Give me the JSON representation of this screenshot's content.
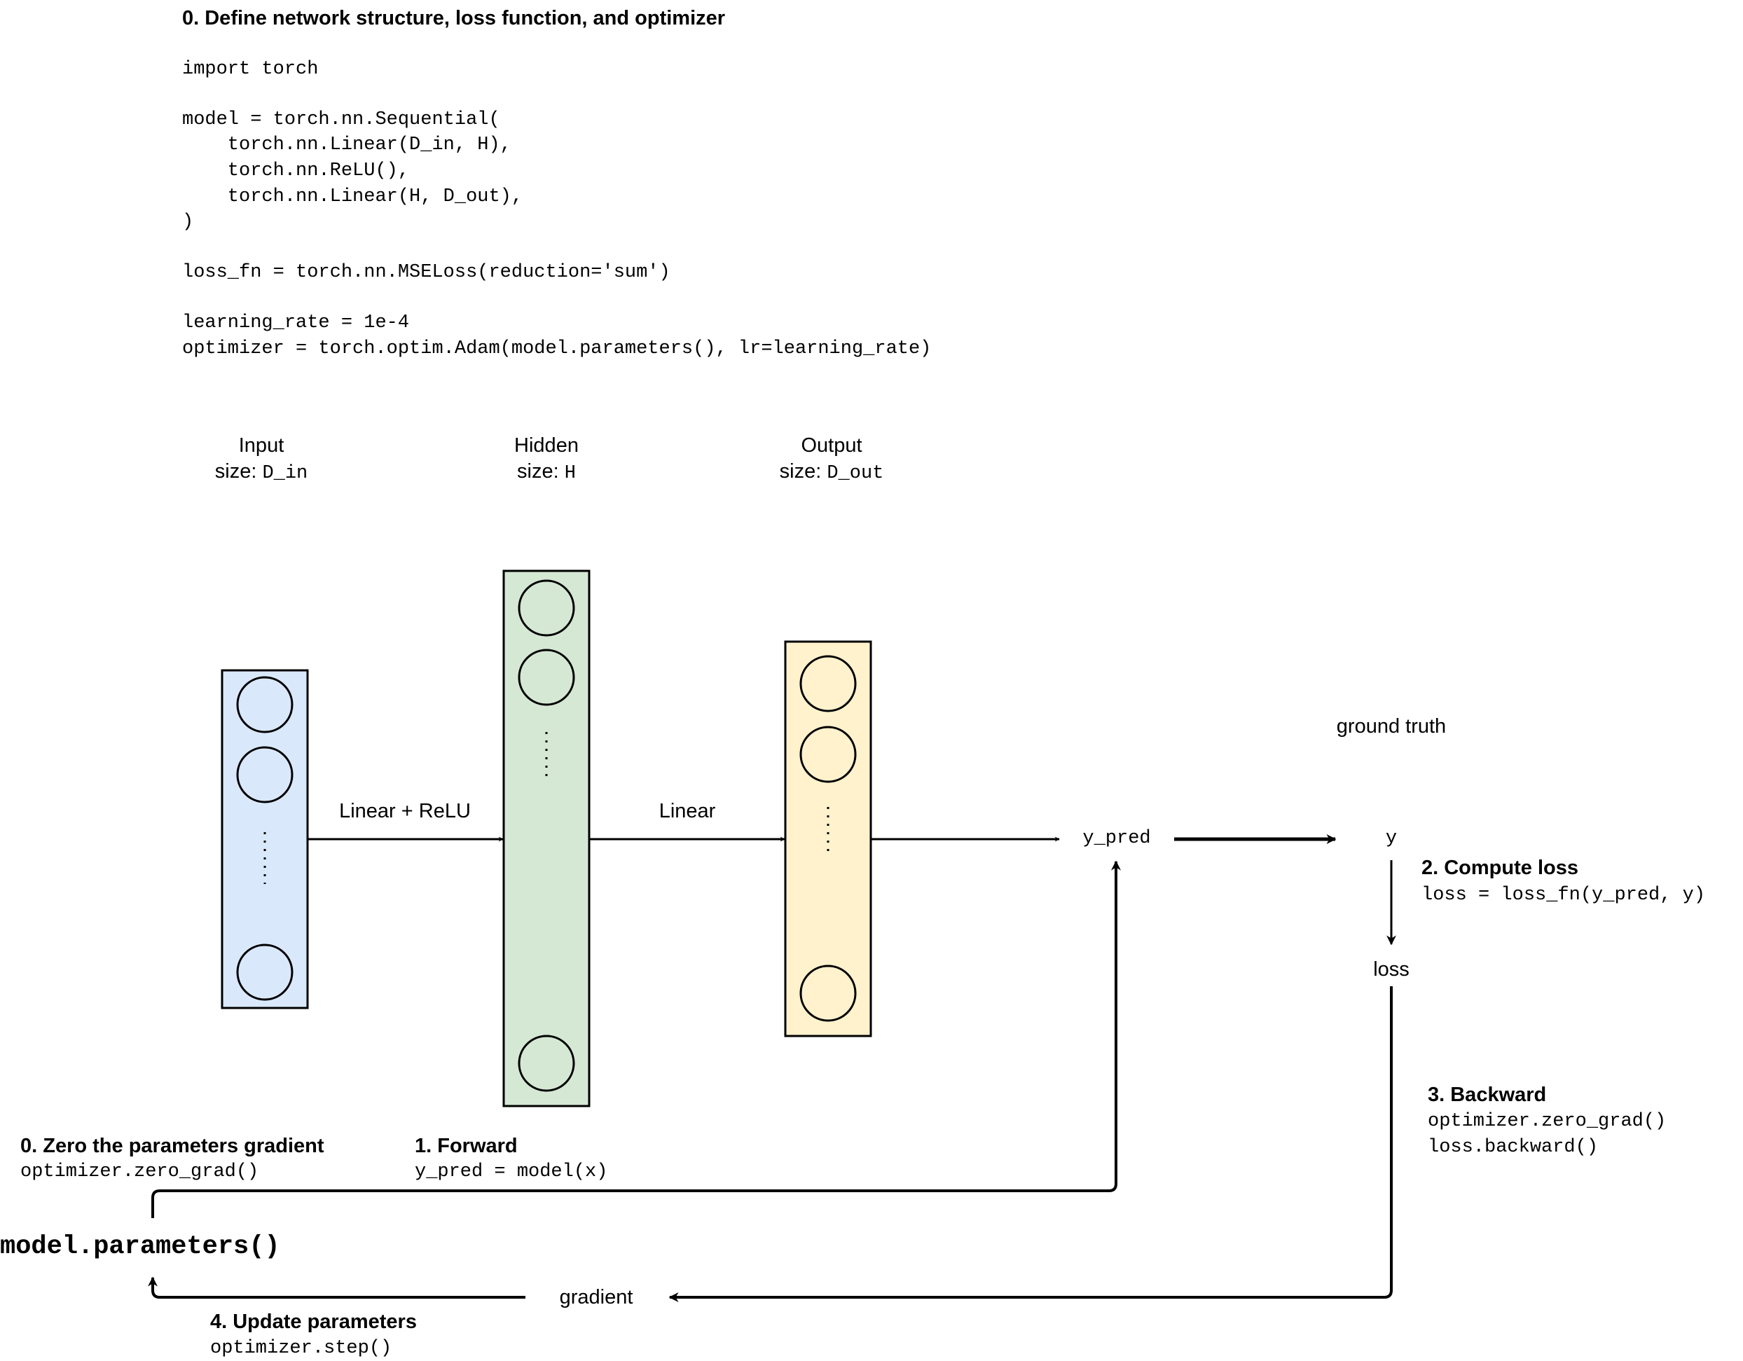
{
  "setup": {
    "title": "0. Define network structure, loss function, and optimizer",
    "code_lines": [
      "import torch",
      "",
      "model = torch.nn.Sequential(",
      "    torch.nn.Linear(D_in, H),",
      "    torch.nn.ReLU(),",
      "    torch.nn.Linear(H, D_out),",
      ")",
      "",
      "loss_fn = torch.nn.MSELoss(reduction='sum')",
      "",
      "learning_rate = 1e-4",
      "optimizer = torch.optim.Adam(model.parameters(), lr=learning_rate)"
    ]
  },
  "layers": [
    {
      "name": "Input",
      "size_prefix": "size: ",
      "size_value": "D_in",
      "color": "#dae8fc"
    },
    {
      "name": "Hidden",
      "size_prefix": "size: ",
      "size_value": "H",
      "color": "#d5e8d4"
    },
    {
      "name": "Output",
      "size_prefix": "size: ",
      "size_value": "D_out",
      "color": "#fff2cc"
    }
  ],
  "connections": {
    "input_to_hidden": "Linear + ReLU",
    "hidden_to_output": "Linear"
  },
  "nodes": {
    "y_pred": "y_pred",
    "y": "y",
    "ground_truth": "ground truth",
    "loss": "loss",
    "gradient": "gradient",
    "parameters": "model.parameters()"
  },
  "steps": {
    "zero_grad": {
      "title": "0. Zero the parameters gradient",
      "code": [
        "optimizer.zero_grad()"
      ]
    },
    "forward": {
      "title": "1. Forward",
      "code": [
        "y_pred = model(x)"
      ]
    },
    "compute_loss": {
      "title": "2. Compute loss",
      "code": [
        "loss = loss_fn(y_pred, y)"
      ]
    },
    "backward": {
      "title": "3. Backward",
      "code": [
        "optimizer.zero_grad()",
        "loss.backward()"
      ]
    },
    "update": {
      "title": "4. Update parameters",
      "code": [
        "optimizer.step()"
      ]
    }
  },
  "colors": {
    "line": "#000000",
    "input_fill": "#dae8fc",
    "hidden_fill": "#d5e8d4",
    "output_fill": "#fff2cc"
  }
}
